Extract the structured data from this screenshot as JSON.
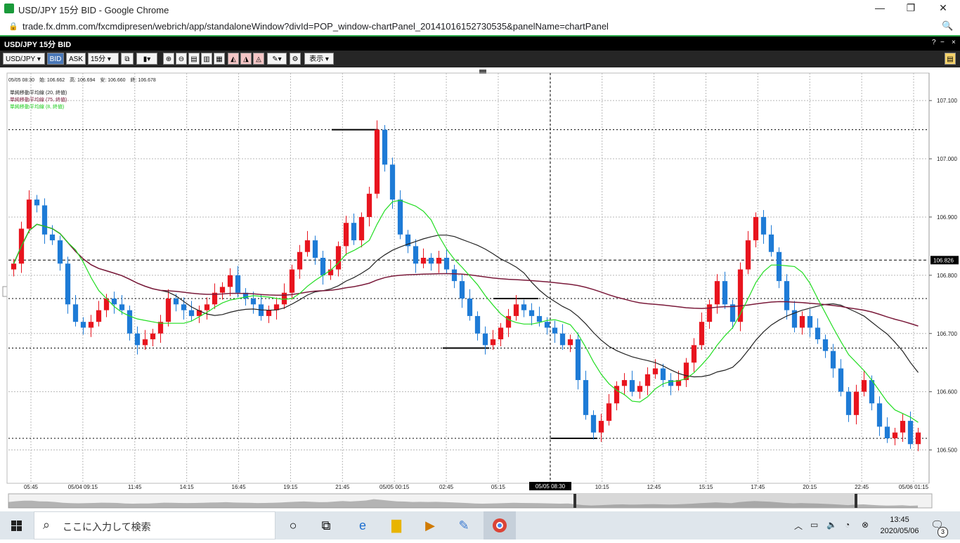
{
  "window": {
    "title": "USD/JPY 15分 BID - Google Chrome",
    "url": "trade.fx.dmm.com/fxcmdipresen/webrich/app/standaloneWindow?divId=POP_window-chartPanel_20141016152730535&panelName=chartPanel"
  },
  "panel": {
    "title": "USD/JPY 15分 BID",
    "buttons": [
      "?",
      "−",
      "□",
      "×"
    ]
  },
  "toolbar": {
    "symbol": "USD/JPY",
    "bid": "BID",
    "ask": "ASK",
    "timeframe": "15分",
    "display": "表示"
  },
  "chart": {
    "ohlc_text": "05/05 08:30　始: 106.662　高: 106.694　安: 106.660　終: 106.678",
    "indicators": [
      {
        "label": "単純移動平均線 (20, 終値)",
        "color": "#222222"
      },
      {
        "label": "単純移動平均線 (75, 終値)",
        "color": "#7a1a3a"
      },
      {
        "label": "単純移動平均線 (8, 終値)",
        "color": "#22dd22"
      }
    ],
    "current_price": "106.826",
    "crosshair_time": "05/05 08:30",
    "colors": {
      "up": "#e8141e",
      "down": "#1e7bd6",
      "ma20": "#222222",
      "ma75": "#7a1a3a",
      "ma8": "#22dd22"
    }
  },
  "chart_data": {
    "type": "candlestick",
    "y_axis_ticks": [
      "107.100",
      "107.000",
      "106.900",
      "106.800",
      "106.700",
      "106.600",
      "106.500"
    ],
    "x_axis_ticks": [
      "05:45",
      "05/04 09:15",
      "11:45",
      "14:15",
      "16:45",
      "19:15",
      "21:45",
      "05/05 00:15",
      "02:45",
      "05:15",
      "07:45",
      "10:15",
      "12:45",
      "15:15",
      "17:45",
      "20:15",
      "22:45",
      "05/06 01:15"
    ],
    "ylim": [
      106.45,
      107.14
    ],
    "close": [
      106.82,
      106.88,
      106.93,
      106.92,
      106.87,
      106.86,
      106.82,
      106.75,
      106.72,
      106.71,
      106.72,
      106.74,
      106.76,
      106.75,
      106.74,
      106.7,
      106.68,
      106.69,
      106.7,
      106.72,
      106.76,
      106.75,
      106.74,
      106.73,
      106.74,
      106.75,
      106.77,
      106.78,
      106.8,
      106.77,
      106.76,
      106.75,
      106.73,
      106.74,
      106.75,
      106.77,
      106.81,
      106.84,
      106.86,
      106.83,
      106.8,
      106.81,
      106.85,
      106.89,
      106.86,
      106.9,
      106.94,
      107.05,
      106.99,
      106.93,
      106.87,
      106.85,
      106.82,
      106.83,
      106.82,
      106.83,
      106.81,
      106.79,
      106.76,
      106.73,
      106.7,
      106.68,
      106.69,
      106.71,
      106.73,
      106.75,
      106.74,
      106.73,
      106.72,
      106.71,
      106.7,
      106.68,
      106.69,
      106.62,
      106.56,
      106.53,
      106.55,
      106.58,
      106.61,
      106.62,
      106.6,
      106.61,
      106.63,
      106.64,
      106.62,
      106.61,
      106.62,
      106.65,
      106.68,
      106.72,
      106.75,
      106.79,
      106.75,
      106.72,
      106.81,
      106.86,
      106.9,
      106.87,
      106.84,
      106.79,
      106.74,
      106.71,
      106.73,
      106.71,
      106.69,
      106.67,
      106.64,
      106.6,
      106.56,
      106.6,
      106.62,
      106.58,
      106.54,
      106.52,
      106.53,
      106.55,
      106.51,
      106.53
    ],
    "series": [
      {
        "name": "単純移動平均線 (20, 終値)"
      },
      {
        "name": "単純移動平均線 (75, 終値)"
      },
      {
        "name": "単純移動平均線 (8, 終値)"
      }
    ],
    "support_resistance_levels": [
      107.05,
      106.76,
      106.675,
      106.52
    ],
    "current_price_line": 106.826
  },
  "taskbar": {
    "search_placeholder": "ここに入力して検索",
    "time": "13:45",
    "date": "2020/05/06",
    "notifications": "3",
    "apps": [
      "task-view",
      "edge",
      "file-explorer",
      "media",
      "paint",
      "chrome"
    ]
  }
}
